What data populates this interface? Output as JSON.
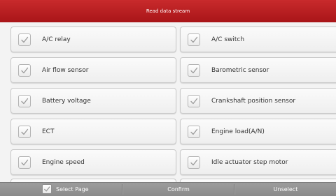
{
  "header": {
    "title": "Read data stream"
  },
  "items": [
    {
      "label": "A/C relay",
      "checked": true
    },
    {
      "label": "A/C switch",
      "checked": true
    },
    {
      "label": "Air flow sensor",
      "checked": true
    },
    {
      "label": "Barometric sensor",
      "checked": true
    },
    {
      "label": "Battery voltage",
      "checked": true
    },
    {
      "label": "Crankshaft position sensor",
      "checked": true
    },
    {
      "label": "ECT",
      "checked": true
    },
    {
      "label": "Engine load(A/N)",
      "checked": true
    },
    {
      "label": "Engine speed",
      "checked": true
    },
    {
      "label": "Idle actuator step motor",
      "checked": true
    }
  ],
  "footer": {
    "select_page_label": "Select Page",
    "select_page_checked": true,
    "confirm_label": "Confirm",
    "unselect_label": "Unselect"
  },
  "icons": {
    "checkbox": "checkmark-icon"
  },
  "colors": {
    "header_red": "#b81c1f",
    "checkmark_gray": "#9a9a9a",
    "footer_gray": "#939393"
  }
}
